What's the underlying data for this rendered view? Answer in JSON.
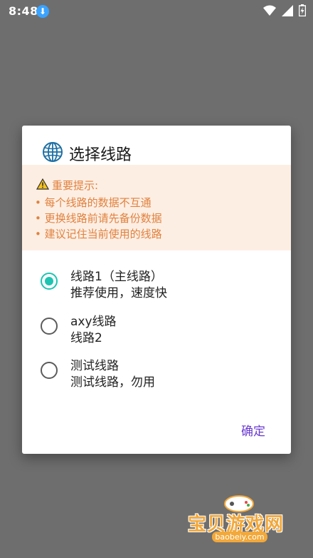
{
  "status_bar": {
    "time": "8:48",
    "download_badge_icon": "download-icon"
  },
  "dialog": {
    "title": "选择线路",
    "title_icon": "globe-icon",
    "notice": {
      "heading": "重要提示:",
      "lines": [
        "• 每个线路的数据不互通",
        "• 更换线路前请先备份数据",
        "• 建议记住当前使用的线路"
      ],
      "text_color": "#e0823f",
      "bg_color": "#fdeee3"
    },
    "options": [
      {
        "title": "线路1（主线路）",
        "subtitle": "推荐使用，速度快",
        "selected": true
      },
      {
        "title": "axy线路",
        "subtitle": "线路2",
        "selected": false
      },
      {
        "title": "测试线路",
        "subtitle": "测试线路，勿用",
        "selected": false
      }
    ],
    "confirm_label": "确定",
    "accent_color": "#1ec4b2"
  },
  "watermark": {
    "text": "宝贝游戏网",
    "url": "baobeiy.com"
  }
}
